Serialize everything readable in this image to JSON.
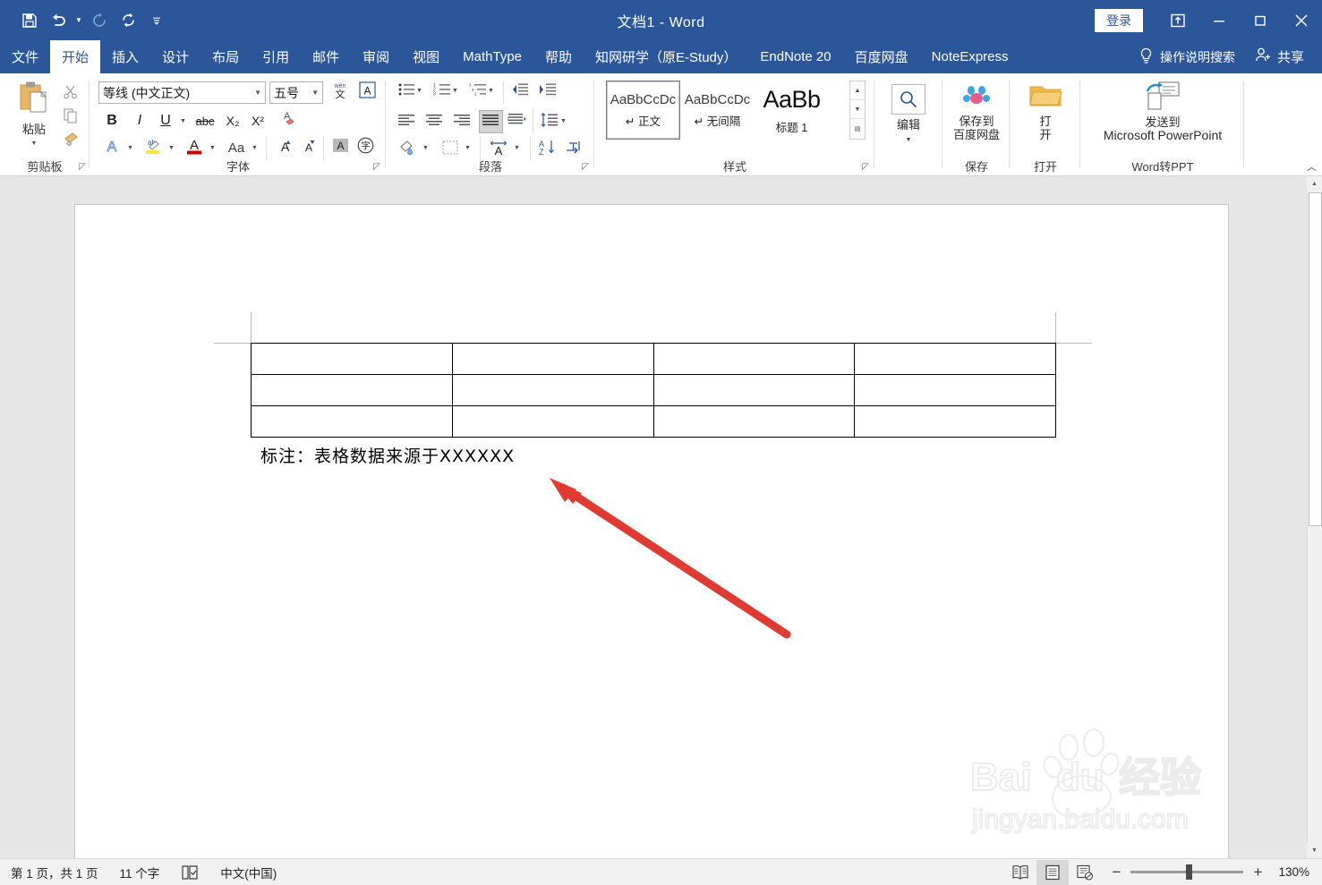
{
  "window": {
    "title": "文档1 - Word",
    "signin_label": "登录",
    "ribbon_display_icon": "ribbon-display-options-icon",
    "minimize_icon": "minimize-icon",
    "maximize_icon": "maximize-icon",
    "close_icon": "close-icon"
  },
  "quick_access": [
    {
      "name": "save-icon",
      "glyph": "save"
    },
    {
      "name": "undo-icon",
      "glyph": "undo"
    },
    {
      "name": "redo-icon",
      "glyph": "redo"
    },
    {
      "name": "refresh-icon",
      "glyph": "refresh"
    },
    {
      "name": "customize-qat-icon",
      "glyph": "caret"
    }
  ],
  "tabs": [
    {
      "label": "文件",
      "active": false
    },
    {
      "label": "开始",
      "active": true
    },
    {
      "label": "插入",
      "active": false
    },
    {
      "label": "设计",
      "active": false
    },
    {
      "label": "布局",
      "active": false
    },
    {
      "label": "引用",
      "active": false
    },
    {
      "label": "邮件",
      "active": false
    },
    {
      "label": "审阅",
      "active": false
    },
    {
      "label": "视图",
      "active": false
    },
    {
      "label": "MathType",
      "active": false
    },
    {
      "label": "帮助",
      "active": false
    },
    {
      "label": "知网研学（原E-Study）",
      "active": false
    },
    {
      "label": "EndNote 20",
      "active": false
    },
    {
      "label": "百度网盘",
      "active": false
    },
    {
      "label": "NoteExpress",
      "active": false
    }
  ],
  "tellme": {
    "label": "操作说明搜索",
    "icon": "lightbulb-icon"
  },
  "share": {
    "label": "共享",
    "icon": "share-person-icon"
  },
  "ribbon": {
    "groups": [
      {
        "label": "剪贴板"
      },
      {
        "label": "字体"
      },
      {
        "label": "段落"
      },
      {
        "label": "样式"
      },
      {
        "label": "保存"
      },
      {
        "label": "打开"
      },
      {
        "label": "Word转PPT"
      }
    ],
    "clipboard": {
      "paste_label": "粘贴",
      "cut_icon": "scissors-icon",
      "copy_icon": "copy-icon",
      "format_painter_icon": "format-painter-icon"
    },
    "font": {
      "font_name": "等线 (中文正文)",
      "font_size": "五号",
      "phonetic_icon": "phonetic-guide-icon",
      "char_border_icon": "character-border-icon",
      "bold": "B",
      "italic": "I",
      "underline": "U",
      "strikethrough": "abc",
      "subscript": "X₂",
      "superscript": "X²",
      "clear_format_icon": "clear-formatting-icon",
      "text_effects_icon": "text-effects-icon",
      "highlight_icon": "text-highlight-icon",
      "font_color_icon": "font-color-icon",
      "change_case_icon": "change-case-icon",
      "grow_font_icon": "grow-font-icon",
      "shrink_font_icon": "shrink-font-icon",
      "char_shading_icon": "character-shading-icon",
      "enclose_char_icon": "enclose-character-icon"
    },
    "paragraph": {
      "bullets_icon": "bullets-icon",
      "numbering_icon": "numbering-icon",
      "multilevel_icon": "multilevel-list-icon",
      "decrease_indent_icon": "decrease-indent-icon",
      "increase_indent_icon": "increase-indent-icon",
      "align_left_icon": "align-left-icon",
      "align_center_icon": "align-center-icon",
      "align_right_icon": "align-right-icon",
      "justify_icon": "justify-icon",
      "distribute_icon": "distribute-icon",
      "line_spacing_icon": "line-spacing-icon",
      "shading_icon": "shading-icon",
      "borders_icon": "borders-icon",
      "asian_layout_icon": "asian-layout-icon",
      "sort_icon": "sort-icon",
      "show_marks_icon": "show-paragraph-marks-icon"
    },
    "styles": [
      {
        "preview": "AaBbCcDc",
        "name": "正文",
        "pilcrow": true,
        "selected": true,
        "heading": false
      },
      {
        "preview": "AaBbCcDc",
        "name": "无间隔",
        "pilcrow": true,
        "selected": false,
        "heading": false
      },
      {
        "preview": "AaBb",
        "name": "标题 1",
        "pilcrow": false,
        "selected": false,
        "heading": true
      }
    ],
    "editing": {
      "label": "编辑",
      "icon": "magnifier-icon"
    },
    "save_group": {
      "label": "保存到\n百度网盘",
      "line1": "保存到",
      "line2": "百度网盘",
      "icon": "baidu-netdisk-icon"
    },
    "open_group": {
      "line1": "打",
      "line2": "开",
      "icon": "open-folder-icon"
    },
    "word2ppt": {
      "line1": "发送到",
      "line2": "Microsoft PowerPoint",
      "icon": "send-to-powerpoint-icon"
    },
    "collapse_icon": "collapse-ribbon-icon"
  },
  "document": {
    "table": {
      "rows": 3,
      "cols": 4,
      "cells": [
        [
          "",
          "",
          "",
          ""
        ],
        [
          "",
          "",
          "",
          ""
        ],
        [
          "",
          "",
          "",
          ""
        ]
      ]
    },
    "caption": "标注：表格数据来源于XXXXXX",
    "annotation_arrow": {
      "name": "red-arrow-annotation",
      "color": "#e03a32"
    }
  },
  "watermark": {
    "brand": "Baidu经验",
    "url": "jingyan.baidu.com"
  },
  "status": {
    "page_info": "第 1 页，共 1 页",
    "word_count": "11 个字",
    "proofing_icon": "proofing-errors-icon",
    "language": "中文(中国)",
    "views": [
      {
        "name": "read-mode-view",
        "icon": "read-mode-icon",
        "selected": false
      },
      {
        "name": "print-layout-view",
        "icon": "print-layout-icon",
        "selected": true
      },
      {
        "name": "web-layout-view",
        "icon": "web-layout-icon",
        "selected": false
      }
    ],
    "zoom_out": "−",
    "zoom_in": "+",
    "zoom_level": "130%"
  }
}
